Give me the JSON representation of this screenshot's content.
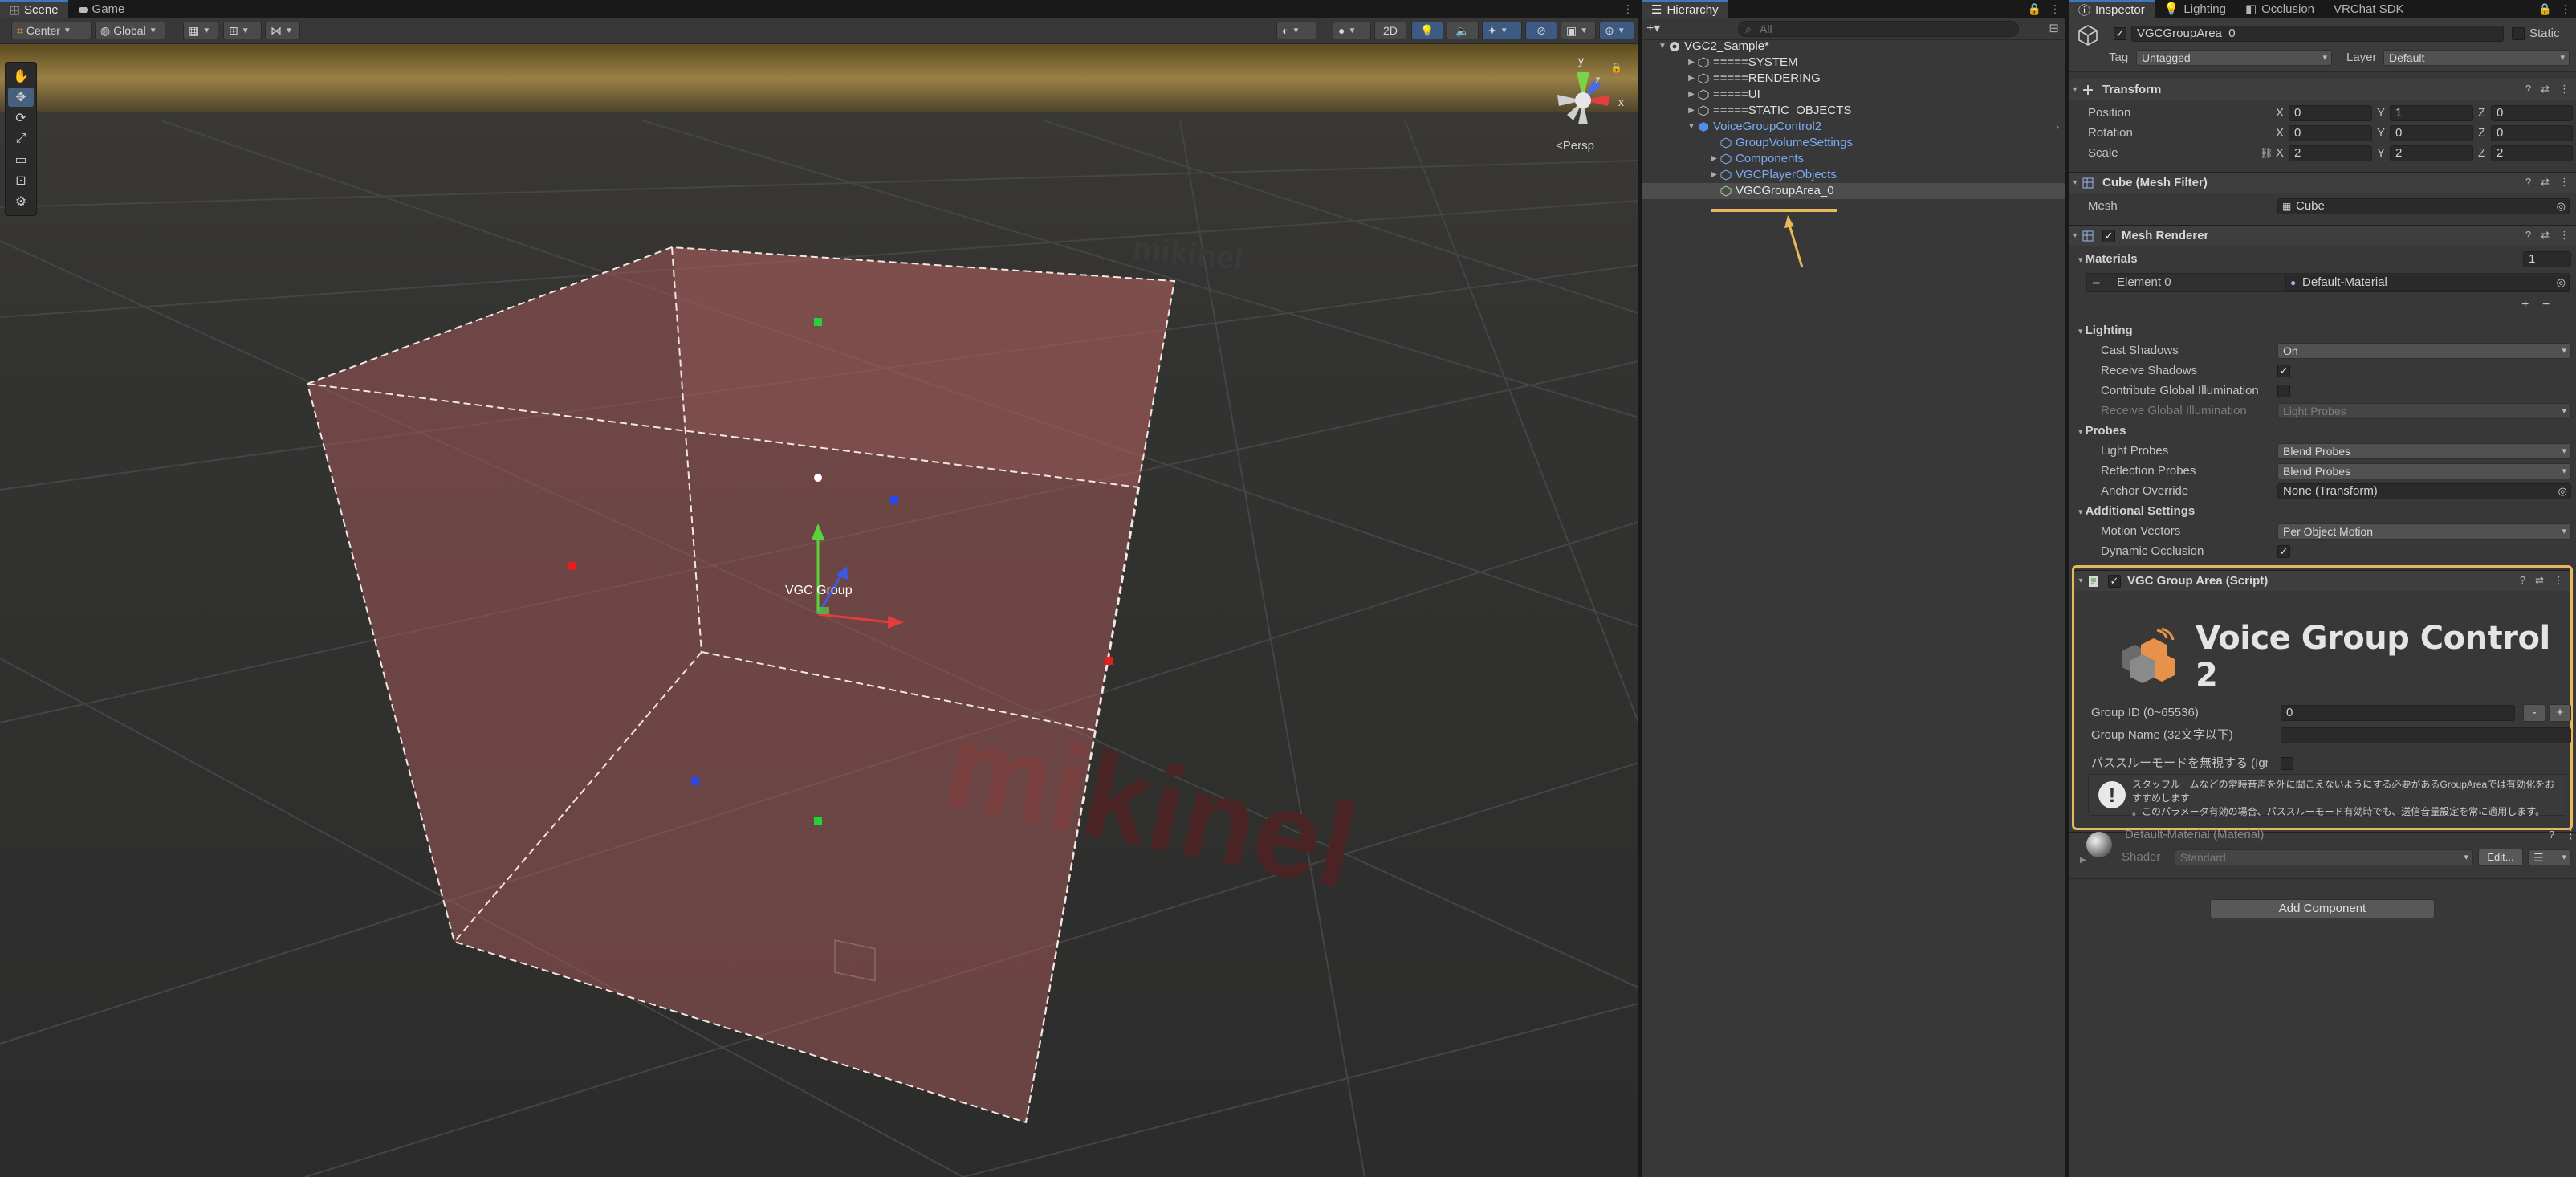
{
  "scene": {
    "tabs": [
      "Scene",
      "Game"
    ],
    "toolbar": {
      "pivot_mode": "Center",
      "pivot_rotation": "Global",
      "mode_2d": "2D"
    },
    "persp_label": "Persp",
    "gizmo_axes": {
      "x": "x",
      "y": "y",
      "z": "z"
    },
    "object_label": "VGC Group",
    "floor_text": "mikinel",
    "floor_text_far": "mikinel"
  },
  "hierarchy": {
    "tab": "Hierarchy",
    "search_placeholder": "All",
    "items": [
      {
        "label": "VGC2_Sample*",
        "kind": "scene"
      },
      {
        "label": "=====SYSTEM",
        "kind": "object"
      },
      {
        "label": "=====RENDERING",
        "kind": "object"
      },
      {
        "label": "=====UI",
        "kind": "object"
      },
      {
        "label": "=====STATIC_OBJECTS",
        "kind": "object"
      },
      {
        "label": "VoiceGroupControl2",
        "kind": "prefab"
      },
      {
        "label": "GroupVolumeSettings",
        "kind": "prefab"
      },
      {
        "label": "Components",
        "kind": "prefab"
      },
      {
        "label": "VGCPlayerObjects",
        "kind": "prefab"
      },
      {
        "label": "VGCGroupArea_0",
        "kind": "selected"
      }
    ]
  },
  "inspector": {
    "tabs": [
      "Inspector",
      "Lighting",
      "Occlusion",
      "VRChat SDK"
    ],
    "object_name": "VGCGroupArea_0",
    "static_label": "Static",
    "tag_label": "Tag",
    "tag_value": "Untagged",
    "layer_label": "Layer",
    "layer_value": "Default",
    "transform": {
      "title": "Transform",
      "position_label": "Position",
      "rotation_label": "Rotation",
      "scale_label": "Scale",
      "position": {
        "x": "0",
        "y": "1",
        "z": "0"
      },
      "rotation": {
        "x": "0",
        "y": "0",
        "z": "0"
      },
      "scale": {
        "x": "2",
        "y": "2",
        "z": "2"
      }
    },
    "mesh_filter": {
      "title": "Cube (Mesh Filter)",
      "mesh_label": "Mesh",
      "mesh_value": "Cube"
    },
    "mesh_renderer": {
      "title": "Mesh Renderer",
      "materials_label": "Materials",
      "materials_count": "1",
      "element0_label": "Element 0",
      "element0_value": "Default-Material",
      "lighting_label": "Lighting",
      "cast_shadows_label": "Cast Shadows",
      "cast_shadows_value": "On",
      "receive_shadows_label": "Receive Shadows",
      "contribute_gi_label": "Contribute Global Illumination",
      "receive_gi_label": "Receive Global Illumination",
      "receive_gi_value": "Light Probes",
      "probes_label": "Probes",
      "light_probes_label": "Light Probes",
      "light_probes_value": "Blend Probes",
      "reflection_probes_label": "Reflection Probes",
      "reflection_probes_value": "Blend Probes",
      "anchor_override_label": "Anchor Override",
      "anchor_override_value": "None (Transform)",
      "additional_label": "Additional Settings",
      "motion_vectors_label": "Motion Vectors",
      "motion_vectors_value": "Per Object Motion",
      "dynamic_occlusion_label": "Dynamic Occlusion"
    },
    "vgc_script": {
      "title": "VGC Group Area (Script)",
      "logo_text": "Voice Group Control 2",
      "group_id_label": "Group ID (0~65536)",
      "group_id_value": "0",
      "minus": "-",
      "plus": "+",
      "group_name_label": "Group Name (32文字以下)",
      "group_name_value": "",
      "ignore_label": "パススルーモードを無視する (IgnorePa",
      "help_line1": "スタッフルームなどの常時音声を外に聞こえないようにする必要があるGroupAreaでは有効化をおすすめします",
      "help_line2": "。このパラメータ有効の場合、パススルーモード有効時でも、送信音量設定を常に適用します。"
    },
    "material": {
      "title": "Default-Material (Material)",
      "shader_label": "Shader",
      "shader_value": "Standard",
      "edit_label": "Edit..."
    },
    "add_component": "Add Component"
  },
  "colors": {
    "accent_blue": "#3a79bb",
    "highlight_orange": "#e6b95c",
    "prefab_blue": "#7dacf5",
    "box_fill": "#a85a5a"
  }
}
